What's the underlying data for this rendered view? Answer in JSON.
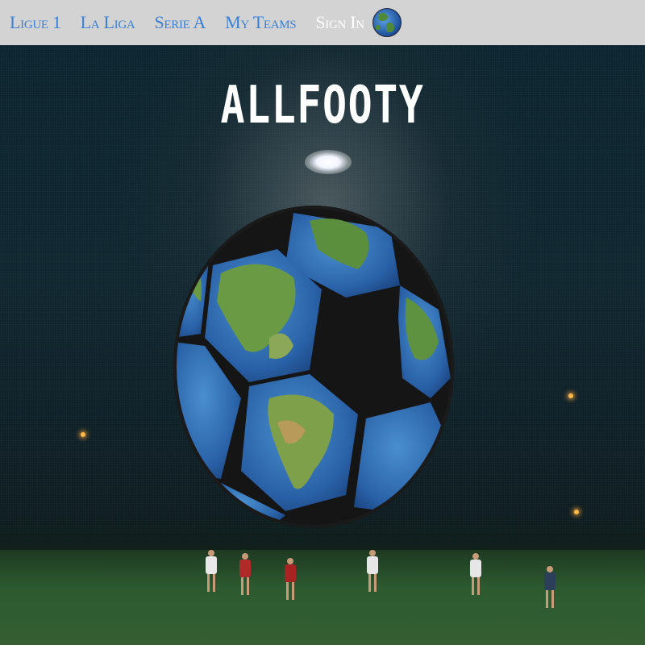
{
  "nav": {
    "links": [
      {
        "label": "Ligue 1"
      },
      {
        "label": "La Liga"
      },
      {
        "label": "Serie A"
      },
      {
        "label": "My Teams"
      }
    ],
    "signin_label": "Sign In",
    "globe_icon": "globe-icon"
  },
  "hero": {
    "title": "ALLFOOTY",
    "ball_icon": "soccer-ball-globe-icon"
  },
  "colors": {
    "nav_background": "#d3d3d3",
    "nav_link": "#3a7fd6",
    "signin": "#ffffff"
  }
}
